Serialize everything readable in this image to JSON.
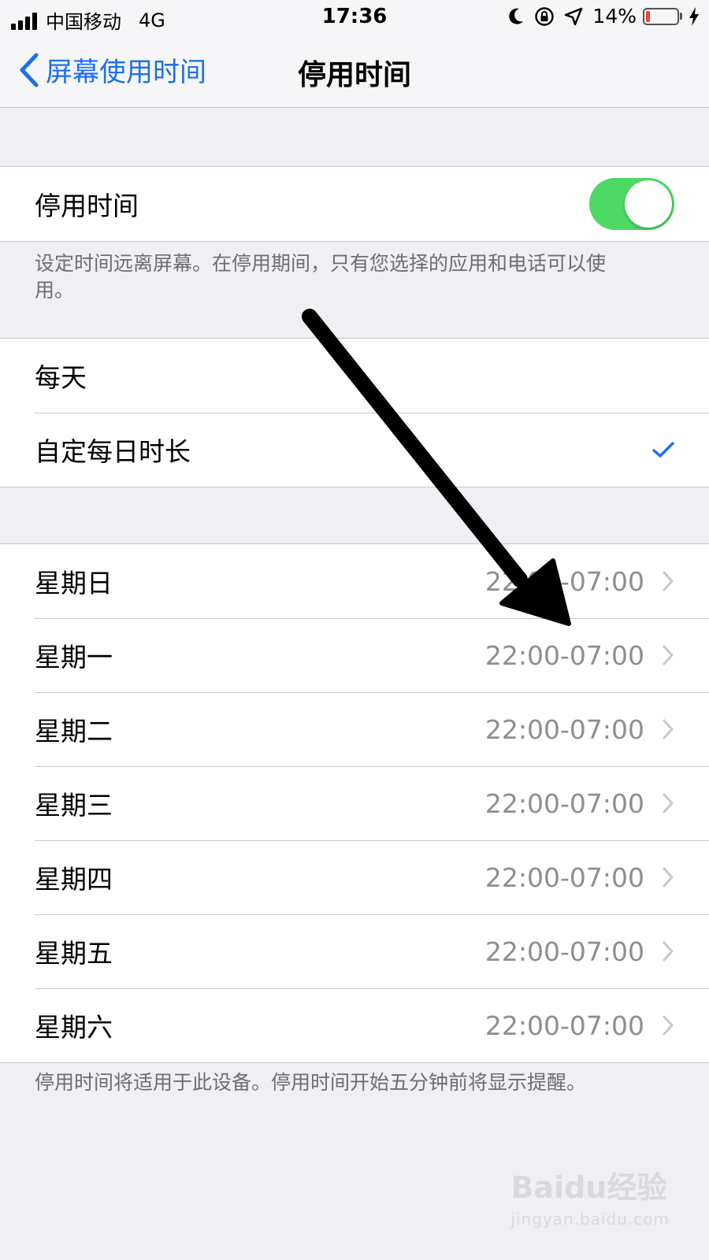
{
  "status_bar": {
    "carrier": "中国移动",
    "network": "4G",
    "time": "17:36",
    "battery": "14%",
    "battery_level": 0.14,
    "icons": [
      "signal-icon",
      "moon-icon",
      "rotation-lock-icon",
      "location-icon",
      "battery-icon",
      "charging-icon"
    ]
  },
  "nav": {
    "back_label": "屏幕使用时间",
    "title": "停用时间"
  },
  "downtime_toggle": {
    "label": "停用时间",
    "on": true,
    "color": "#4cd964"
  },
  "downtime_description": "设定时间远离屏幕。在停用期间，只有您选择的应用和电话可以使用。",
  "schedule_options": [
    {
      "label": "每天",
      "selected": false
    },
    {
      "label": "自定每日时长",
      "selected": true
    }
  ],
  "days": [
    {
      "label": "星期日",
      "time": "22:00-07:00"
    },
    {
      "label": "星期一",
      "time": "22:00-07:00"
    },
    {
      "label": "星期二",
      "time": "22:00-07:00"
    },
    {
      "label": "星期三",
      "time": "22:00-07:00"
    },
    {
      "label": "星期四",
      "time": "22:00-07:00"
    },
    {
      "label": "星期五",
      "time": "22:00-07:00"
    },
    {
      "label": "星期六",
      "time": "22:00-07:00"
    }
  ],
  "footer_note": "停用时间将适用于此设备。停用时间开始五分钟前将显示提醒。",
  "watermark": {
    "brand": "Baidu经验",
    "url": "jingyan.baidu.com"
  },
  "colors": {
    "accent": "#1b6ff0",
    "check": "#1b6ff0",
    "secondary_text": "#8e8e93",
    "background": "#efeff4"
  }
}
